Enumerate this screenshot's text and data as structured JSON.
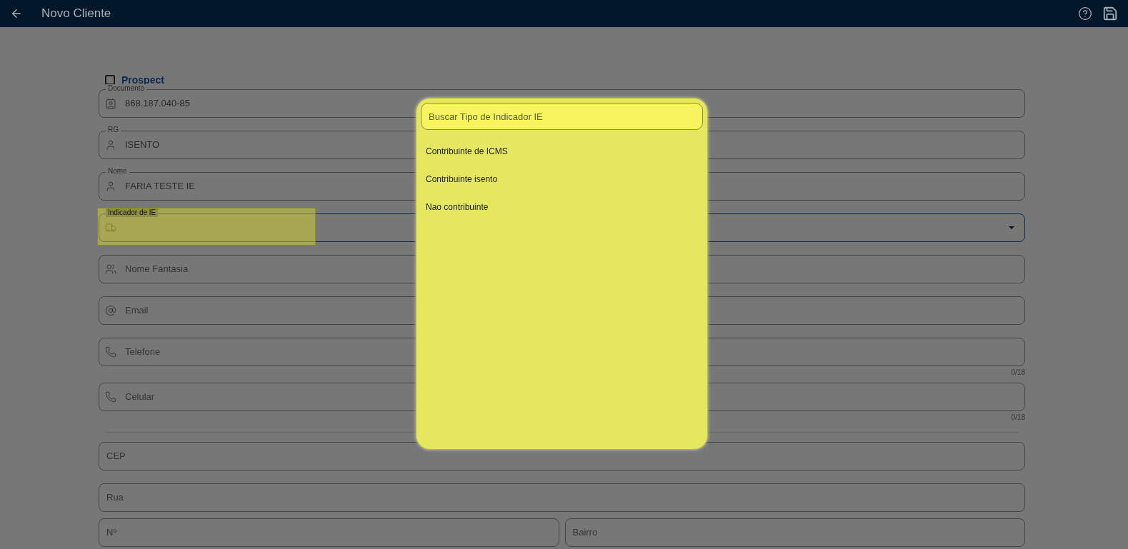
{
  "header": {
    "title": "Novo Cliente"
  },
  "prospect": {
    "label": "Prospect",
    "checked": false
  },
  "fields": [
    {
      "kind": "text",
      "label": "Documento",
      "value": "868.187.040-85"
    },
    {
      "kind": "text",
      "label": "RG",
      "value": "ISENTO"
    },
    {
      "kind": "text",
      "label": "Nome",
      "value": "FARIA TESTE IE"
    },
    {
      "kind": "select",
      "label": "Indicador de IE",
      "focused": true,
      "highlighted": true
    },
    {
      "kind": "text",
      "placeholder": "Nome Fantasia"
    },
    {
      "kind": "text",
      "placeholder": "Email"
    },
    {
      "kind": "text",
      "placeholder": "Telefone",
      "counter": "0/18"
    },
    {
      "kind": "text",
      "placeholder": "Celular",
      "counter": "0/18"
    },
    {
      "kind": "divider"
    },
    {
      "kind": "text",
      "placeholder": "CEP"
    },
    {
      "kind": "text",
      "placeholder": "Rua"
    },
    {
      "kind": "pair",
      "items": [
        {
          "placeholder": "Nº"
        },
        {
          "placeholder": "Bairro"
        }
      ]
    }
  ],
  "dialog": {
    "search": {
      "placeholder": "Buscar Tipo de Indicador IE"
    },
    "options": [
      "Contribuinte de ICMS",
      "Contribuinte isento",
      "Nao contribuinte"
    ]
  }
}
